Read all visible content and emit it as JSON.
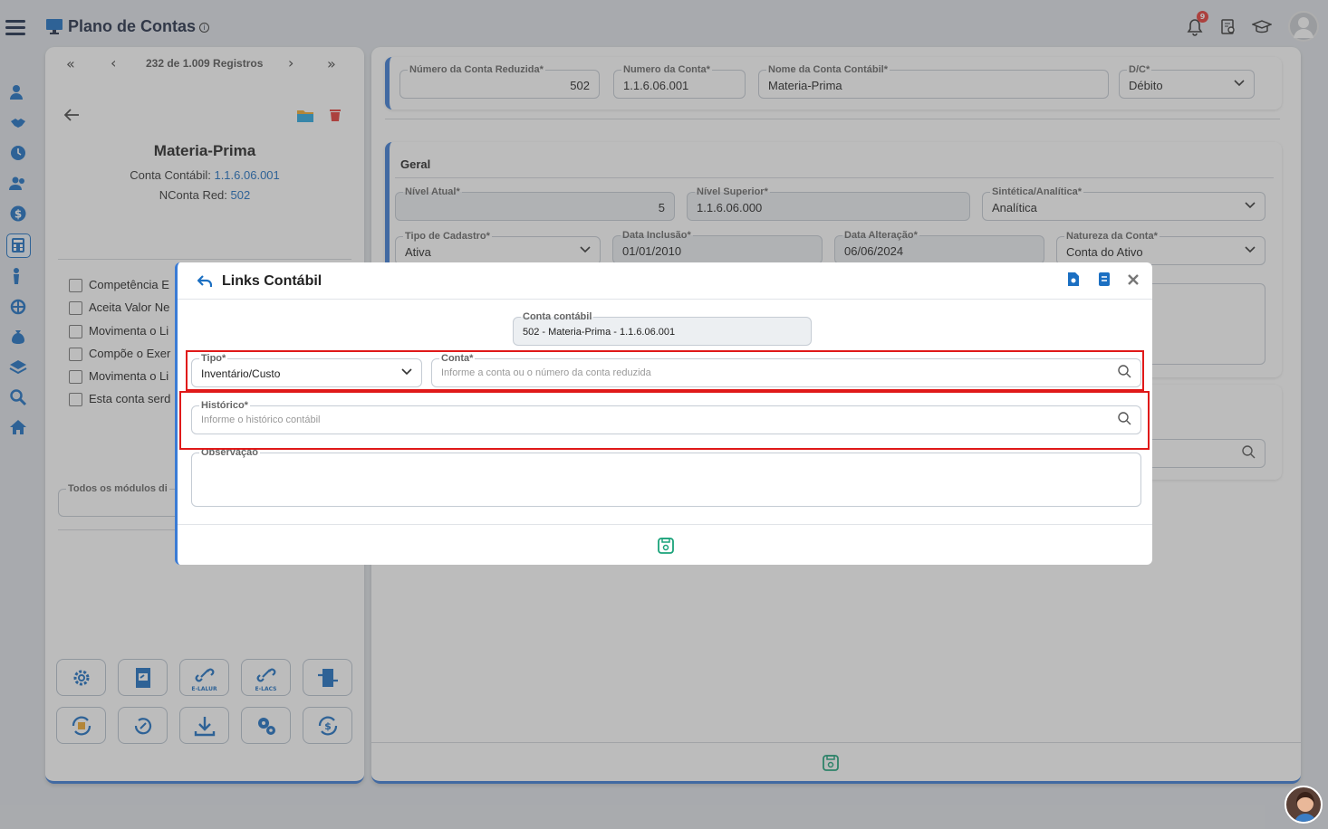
{
  "app": {
    "title": "Plano de Contas",
    "notifications": "9"
  },
  "nav": {
    "records": "232 de 1.009 Registros",
    "first": "«",
    "prev": "‹",
    "next": "›",
    "last": "»"
  },
  "record": {
    "name": "Materia-Prima",
    "conta_label": "Conta Contábil:",
    "conta_value": "1.1.6.06.001",
    "nconta_label": "NConta Red:",
    "nconta_value": "502"
  },
  "checks": [
    {
      "label": "Competência E"
    },
    {
      "label": "Aceita Valor Ne"
    },
    {
      "label": "Movimenta o Li"
    },
    {
      "label": "Compõe o Exer"
    },
    {
      "label": "Movimenta o Li"
    },
    {
      "label": "Esta conta serd"
    }
  ],
  "modulos_label": "Todos os módulos di",
  "bottom_buttons": {
    "elalur": "E-LALUR",
    "elacs": "E-LACS"
  },
  "header_fields": {
    "num_reduzida": {
      "label": "Número da Conta Reduzida*",
      "value": "502"
    },
    "numero": {
      "label": "Numero da Conta*",
      "value": "1.1.6.06.001"
    },
    "nome": {
      "label": "Nome da Conta Contábil*",
      "value": "Materia-Prima"
    },
    "dc": {
      "label": "D/C*",
      "value": "Débito"
    }
  },
  "geral": {
    "title": "Geral",
    "nivel_atual": {
      "label": "Nível Atual*",
      "value": "5"
    },
    "nivel_superior": {
      "label": "Nível Superior*",
      "value": "1.1.6.06.000"
    },
    "sintetica": {
      "label": "Sintética/Analítica*",
      "value": "Analítica"
    },
    "tipo_cadastro": {
      "label": "Tipo de Cadastro*",
      "value": "Ativa"
    },
    "data_inclusao": {
      "label": "Data Inclusão*",
      "value": "01/01/2010"
    },
    "data_alteracao": {
      "label": "Data Alteração*",
      "value": "06/06/2024"
    },
    "natureza": {
      "label": "Natureza da Conta*",
      "value": "Conta do Ativo"
    }
  },
  "modal": {
    "title": "Links Contábil",
    "conta_contabil": {
      "label": "Conta contábil",
      "value": "502 - Materia-Prima - 1.1.6.06.001"
    },
    "tipo": {
      "label": "Tipo*",
      "value": "Inventário/Custo"
    },
    "conta": {
      "label": "Conta*",
      "placeholder": "Informe a conta ou o número da conta reduzida"
    },
    "historico": {
      "label": "Histórico*",
      "placeholder": "Informe o histórico contábil"
    },
    "observacao": {
      "label": "Observação"
    }
  },
  "colors": {
    "accent": "#3a7bd5",
    "highlight": "#e01919",
    "save": "#1aa37a"
  }
}
